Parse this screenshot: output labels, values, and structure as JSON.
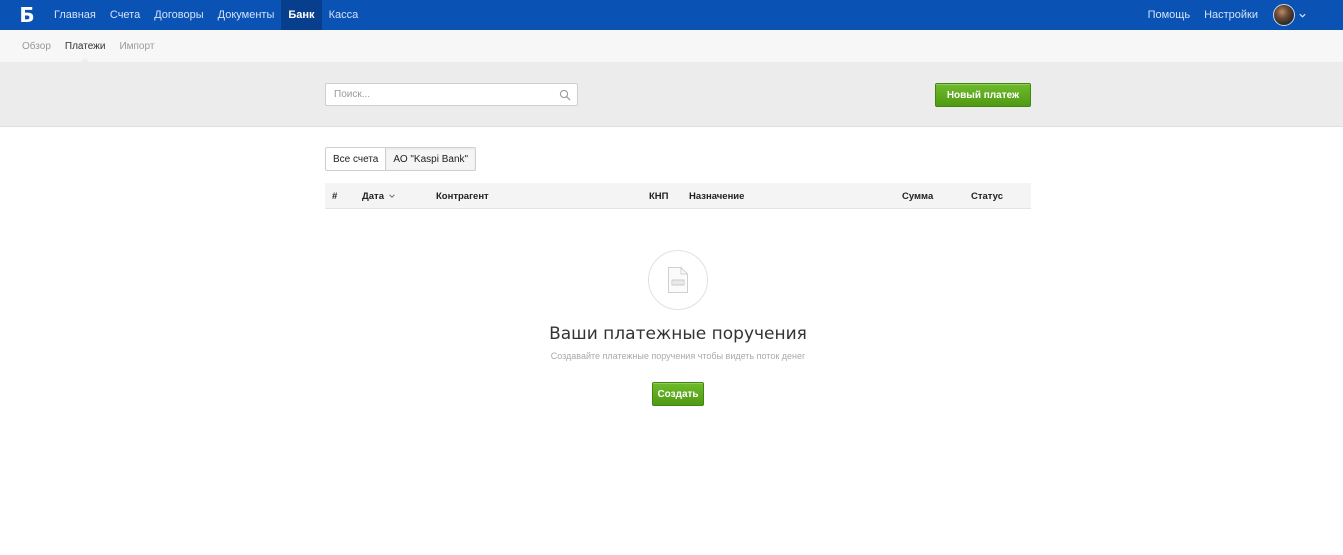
{
  "header": {
    "logo": "Б",
    "nav": [
      {
        "label": "Главная"
      },
      {
        "label": "Счета"
      },
      {
        "label": "Договоры"
      },
      {
        "label": "Документы"
      },
      {
        "label": "Банк",
        "active": true
      },
      {
        "label": "Касса"
      }
    ],
    "right": {
      "help_label": "Помощь",
      "settings_label": "Настройки"
    }
  },
  "subnav": {
    "items": [
      {
        "label": "Обзор"
      },
      {
        "label": "Платежи",
        "active": true
      },
      {
        "label": "Импорт"
      }
    ]
  },
  "toolbar": {
    "search_placeholder": "Поиск...",
    "search_value": "",
    "new_payment_label": "Новый платеж"
  },
  "account_tabs": [
    {
      "label": "Все счета"
    },
    {
      "label": "АО \"Kaspi Bank\"",
      "active": true
    }
  ],
  "table": {
    "columns": {
      "num": "#",
      "date": "Дата",
      "counterparty": "Контрагент",
      "knp": "КНП",
      "purpose": "Назначение",
      "sum": "Сумма",
      "status": "Статус"
    },
    "rows": []
  },
  "empty_state": {
    "title": "Ваши платежные поручения",
    "subtitle": "Создавайте платежные поручения чтобы видеть поток денег",
    "create_label": "Создать"
  },
  "colors": {
    "topbar": "#0a52b4",
    "topbar_active": "#073f8c",
    "primary_button": "#5aa81c",
    "toolbar_band": "#ececec"
  }
}
